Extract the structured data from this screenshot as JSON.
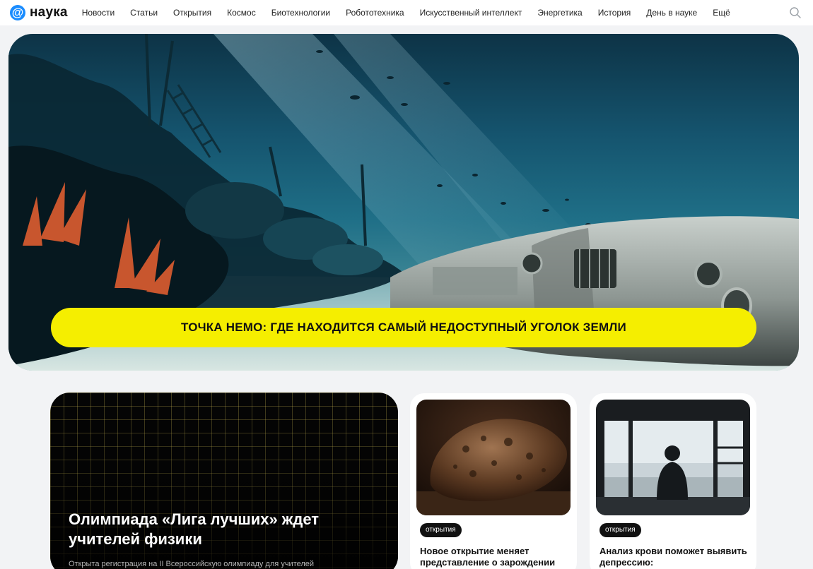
{
  "header": {
    "logo_mark": "@",
    "logo_text": "наука",
    "nav": [
      "Новости",
      "Статьи",
      "Открытия",
      "Космос",
      "Биотехнологии",
      "Робототехника",
      "Искусственный интеллект",
      "Энергетика",
      "История",
      "День в науке",
      "Ещё"
    ]
  },
  "hero": {
    "title": "ТОЧКА НЕМО: ГДЕ НАХОДИТСЯ САМЫЙ НЕДОСТУПНЫЙ УГОЛОК ЗЕМЛИ"
  },
  "feature": {
    "title": "Олимпиада «Лига лучших» ждет учителей физики",
    "description": "Открыта регистрация на II Всероссийскую олимпиаду для учителей"
  },
  "cards": [
    {
      "tag": "открытия",
      "title": "Новое открытие меняет представление о зарождении"
    },
    {
      "tag": "открытия",
      "title": "Анализ крови поможет выявить депрессию:"
    }
  ],
  "colors": {
    "accent_yellow": "#f5ee00",
    "brand_blue": "#1a8cff",
    "page_bg": "#f2f3f5"
  },
  "icons": {
    "logo": "at-sign-logo-icon",
    "search": "search-icon"
  }
}
